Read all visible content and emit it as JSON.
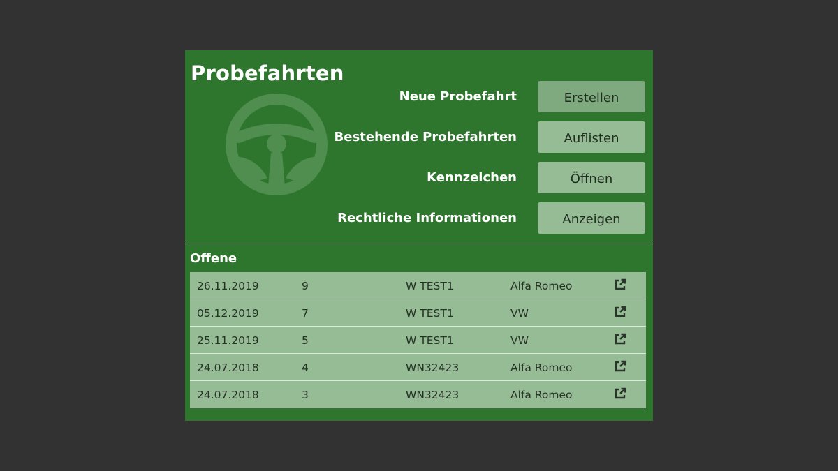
{
  "header": {
    "title": "Probefahrten",
    "wheel_icon": "steering-wheel-icon"
  },
  "actions": [
    {
      "label": "Neue Probefahrt",
      "button": "Erstellen",
      "active": true
    },
    {
      "label": "Bestehende Probefahrten",
      "button": "Auflisten",
      "active": false
    },
    {
      "label": "Kennzeichen",
      "button": "Öffnen",
      "active": false
    },
    {
      "label": "Rechtliche Informationen",
      "button": "Anzeigen",
      "active": false
    }
  ],
  "open_section": {
    "title": "Offene",
    "open_icon": "external-link-icon",
    "rows": [
      {
        "date": "26.11.2019",
        "nr": "9",
        "plate": "W TEST1",
        "brand": "Alfa Romeo"
      },
      {
        "date": "05.12.2019",
        "nr": "7",
        "plate": "W TEST1",
        "brand": "VW"
      },
      {
        "date": "25.11.2019",
        "nr": "5",
        "plate": "W TEST1",
        "brand": "VW"
      },
      {
        "date": "24.07.2018",
        "nr": "4",
        "plate": "WN32423",
        "brand": "Alfa Romeo"
      },
      {
        "date": "24.07.2018",
        "nr": "3",
        "plate": "WN32423",
        "brand": "Alfa Romeo"
      }
    ]
  },
  "colors": {
    "background": "#323232",
    "panel": "#2e752e",
    "button": "#96bc96",
    "button_active": "#7faa7f",
    "row": "#96bc96"
  }
}
